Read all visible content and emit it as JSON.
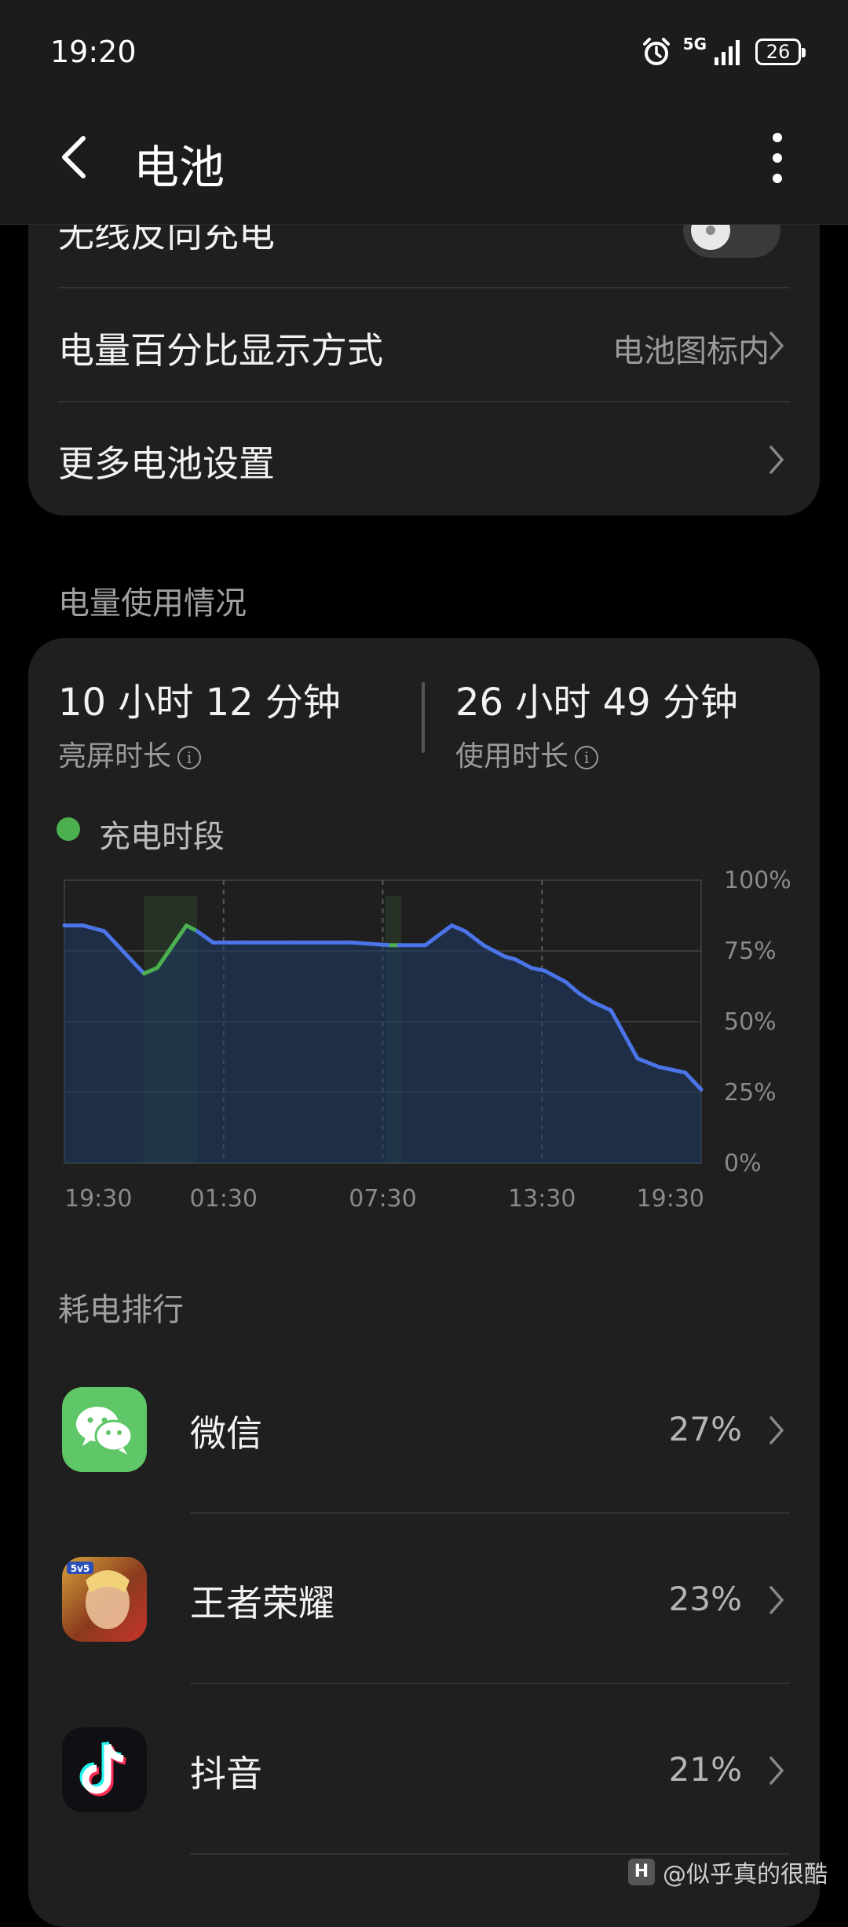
{
  "status_bar": {
    "time": "19:20",
    "network": "5G",
    "battery": "26"
  },
  "header": {
    "title": "电池",
    "back_icon": "chevron-left-icon",
    "more_icon": "more-vertical-icon"
  },
  "settings": {
    "wireless_reverse": {
      "label": "无线反向充电",
      "enabled": false
    },
    "percent_display": {
      "label": "电量百分比显示方式",
      "value": "电池图标内"
    },
    "more_settings": {
      "label": "更多电池设置"
    }
  },
  "usage": {
    "section_title": "电量使用情况",
    "screen_on": {
      "value": "10 小时 12 分钟",
      "label": "亮屏时长"
    },
    "usage_time": {
      "value": "26 小时 49 分钟",
      "label": "使用时长"
    },
    "legend": "充电时段",
    "legend_color": "#4caf50",
    "line_color": "#4a74e8"
  },
  "chart_data": {
    "type": "area",
    "x_ticks": [
      "19:30",
      "01:30",
      "07:30",
      "13:30",
      "19:30"
    ],
    "y_ticks": [
      "100%",
      "75%",
      "50%",
      "25%",
      "0%"
    ],
    "ylim": [
      0,
      100
    ],
    "x_hours": [
      0,
      0.7,
      1.5,
      3.0,
      3.5,
      4.6,
      5.0,
      5.6,
      6.8,
      8.5,
      10.8,
      12.3,
      12.6,
      13.6,
      14.6,
      15.1,
      15.8,
      16.6,
      17.0,
      17.6,
      18.1,
      18.9,
      19.4,
      19.9,
      20.6,
      21.6,
      22.4,
      23.4,
      24.0
    ],
    "battery_percent": [
      84,
      84,
      82,
      67,
      69,
      84,
      82,
      78,
      78,
      78,
      78,
      77,
      77,
      77,
      84,
      82,
      77,
      73,
      72,
      69,
      68,
      64,
      60,
      57,
      54,
      37,
      34,
      32,
      26
    ],
    "charging_periods": [
      [
        3.0,
        5.0
      ],
      [
        12.1,
        12.7
      ]
    ],
    "grid": true
  },
  "ranking": {
    "section_title": "耗电排行",
    "apps": [
      {
        "name": "微信",
        "percent": "27%",
        "icon": "wechat-icon"
      },
      {
        "name": "王者荣耀",
        "percent": "23%",
        "icon": "honor-of-kings-icon"
      },
      {
        "name": "抖音",
        "percent": "21%",
        "icon": "douyin-icon"
      }
    ]
  },
  "watermark": {
    "text": "@似乎真的很酷",
    "logo": "H"
  }
}
